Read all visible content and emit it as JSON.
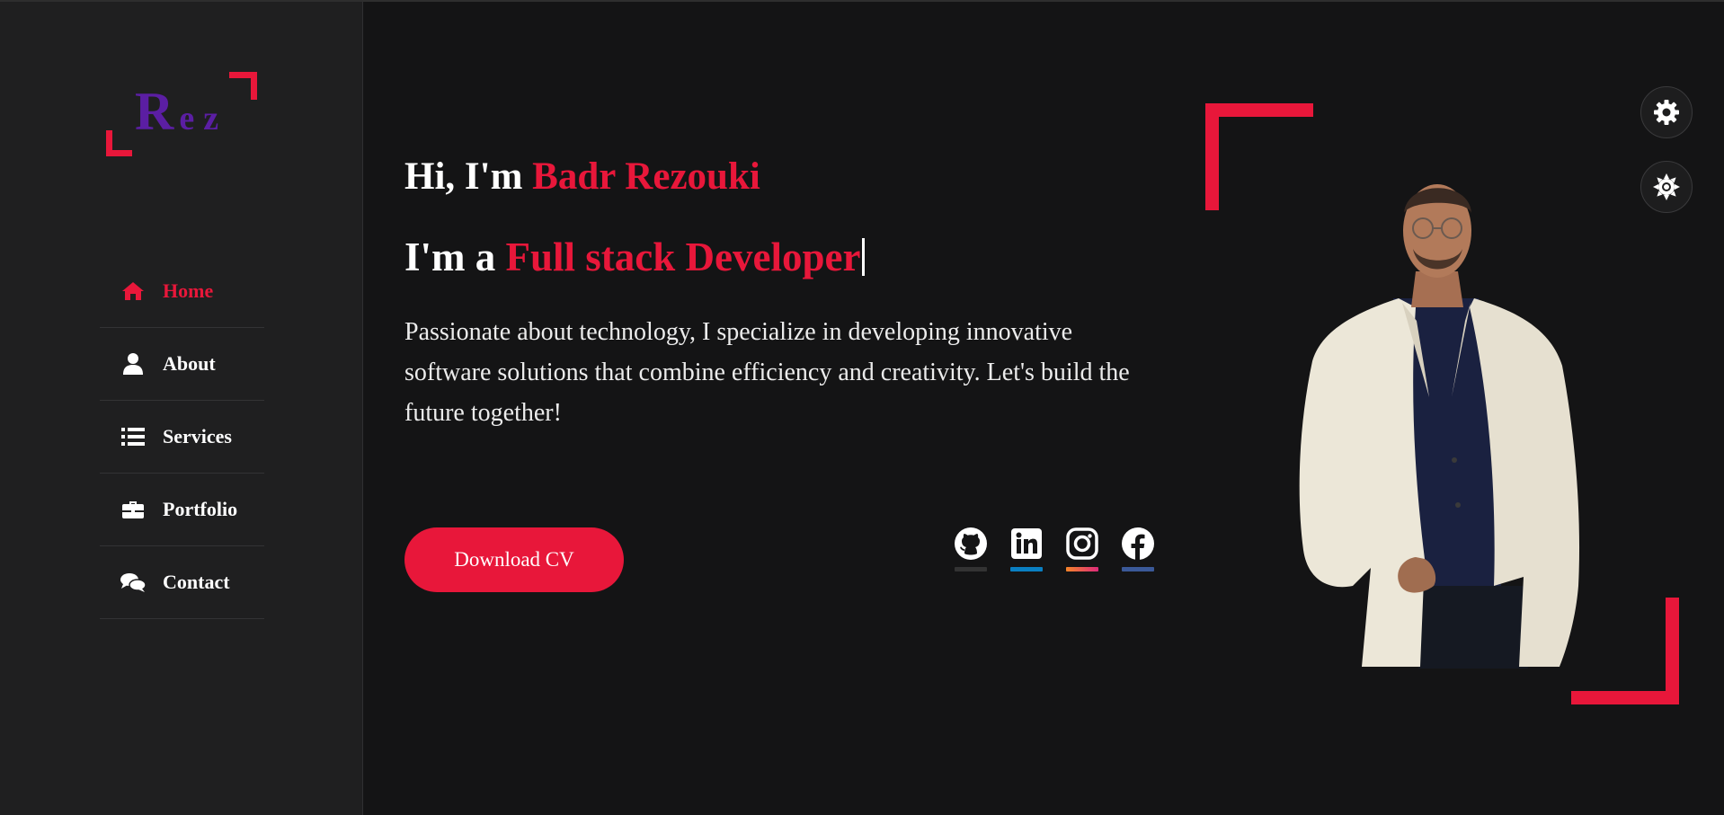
{
  "logo": {
    "first_letter": "R",
    "rest": "ez"
  },
  "nav": {
    "items": [
      {
        "label": "Home",
        "icon": "home-icon",
        "active": true
      },
      {
        "label": "About",
        "icon": "user-icon",
        "active": false
      },
      {
        "label": "Services",
        "icon": "list-icon",
        "active": false
      },
      {
        "label": "Portfolio",
        "icon": "briefcase-icon",
        "active": false
      },
      {
        "label": "Contact",
        "icon": "comments-icon",
        "active": false
      }
    ]
  },
  "hero": {
    "greeting_prefix": "Hi, I'm ",
    "name": "Badr Rezouki",
    "role_prefix": "I'm a ",
    "role": "Full stack Developer",
    "description": "Passionate about technology, I specialize in developing innovative software solutions that combine efficiency and creativity. Let's build the future together!",
    "cv_button": "Download CV"
  },
  "socials": [
    {
      "name": "github-icon",
      "color": "#333333"
    },
    {
      "name": "linkedin-icon",
      "color": "#0a7fc2"
    },
    {
      "name": "instagram-icon",
      "color": "#e1306c"
    },
    {
      "name": "facebook-icon",
      "color": "#3b5998"
    }
  ],
  "colors": {
    "accent": "#e8173a",
    "logo": "#5b1ea3",
    "background": "#141415",
    "sidebar": "#1f1f20"
  }
}
